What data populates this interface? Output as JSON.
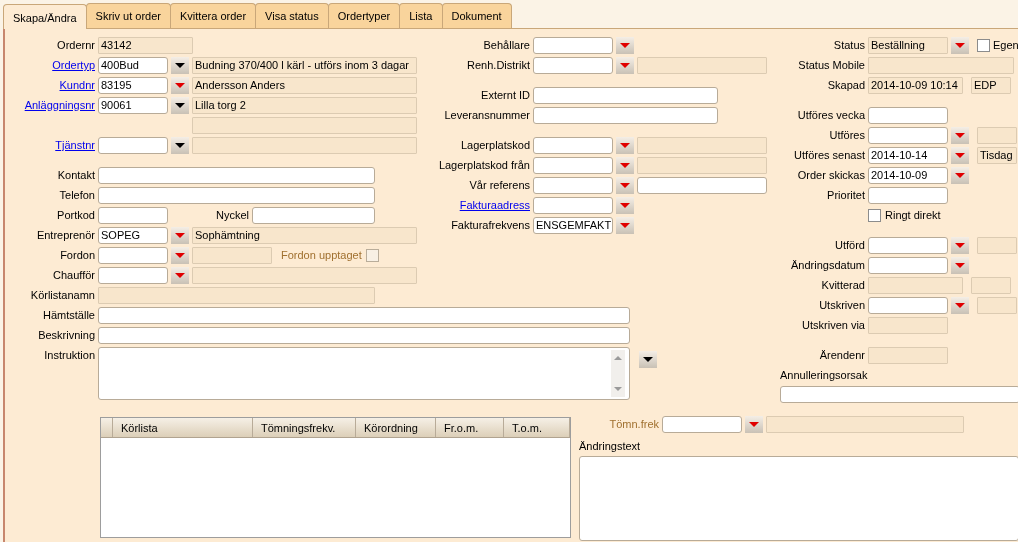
{
  "tabs": [
    {
      "label": "Skapa/Ändra",
      "selected": true
    },
    {
      "label": "Skriv ut order",
      "selected": false
    },
    {
      "label": "Kvittera order",
      "selected": false
    },
    {
      "label": "Visa status",
      "selected": false
    },
    {
      "label": "Ordertyper",
      "selected": false
    },
    {
      "label": "Lista",
      "selected": false
    },
    {
      "label": "Dokument",
      "selected": false
    }
  ],
  "left_groups": [
    [
      {
        "kind": "medium",
        "label": "Ordernr",
        "link": false,
        "field": {
          "value": "43142",
          "readonly": true
        }
      },
      {
        "kind": "text",
        "label": "Ordertyp",
        "link": true,
        "field": {
          "value": "400Bud",
          "readonly": false
        },
        "dropdown": {
          "color": "#000000"
        },
        "extra": {
          "value": "Budning 370/400 l kärl - utförs inom 3 dagar",
          "readonly": true
        }
      },
      {
        "kind": "text",
        "label": "Kundnr",
        "link": true,
        "field": {
          "value": "83195",
          "readonly": false
        },
        "dropdown": {
          "color": "#e00000"
        },
        "extra": {
          "value": "Andersson Anders",
          "readonly": true
        }
      },
      {
        "kind": "text",
        "label": "Anläggningsnr",
        "link": true,
        "field": {
          "value": "90061",
          "readonly": false
        },
        "dropdown": {
          "color": "#000000"
        },
        "extra": {
          "value": "Lilla torg 2",
          "readonly": true
        }
      },
      {
        "kind": "extra-only",
        "extra": {
          "readonly": true
        }
      },
      {
        "kind": "text",
        "label": "Tjänstnr",
        "link": true,
        "field": {
          "readonly": false
        },
        "dropdown": {
          "color": "#000000"
        },
        "extra": {
          "readonly": true
        }
      }
    ],
    [
      {
        "kind": "wide",
        "label": "Kontakt",
        "link": false,
        "field": {
          "readonly": false
        }
      },
      {
        "kind": "wide",
        "label": "Telefon",
        "link": false,
        "field": {
          "readonly": false
        }
      },
      {
        "kind": "text",
        "label": "Portkod",
        "link": false,
        "field": {
          "readonly": false
        },
        "second": {
          "label": "Nyckel",
          "field": {
            "readonly": false
          }
        }
      },
      {
        "kind": "text",
        "label": "Entreprenör",
        "link": false,
        "field": {
          "value": "SOPEG",
          "readonly": false
        },
        "dropdown": {
          "color": "#e00000"
        },
        "extra": {
          "value": "Sophämtning",
          "readonly": true
        }
      },
      {
        "kind": "text",
        "label": "Fordon",
        "link": false,
        "field": {
          "readonly": false
        },
        "dropdown": {
          "color": "#e00000"
        },
        "extra": {
          "readonly": true
        },
        "check": {
          "label": "Fordon upptaget",
          "checked": false,
          "disabled": true
        }
      },
      {
        "kind": "text",
        "label": "Chaufför",
        "link": false,
        "field": {
          "readonly": false
        },
        "dropdown": {
          "color": "#e00000"
        },
        "extra": {
          "readonly": true
        }
      },
      {
        "kind": "wide",
        "label": "Körlistanamn",
        "link": false,
        "field": {
          "readonly": true
        }
      }
    ]
  ],
  "middle_groups": [
    [
      {
        "kind": "text",
        "label": "Behållare",
        "link": false,
        "field": {
          "readonly": false
        },
        "dropdown": {
          "color": "#e00000"
        }
      },
      {
        "kind": "text",
        "label": "Renh.Distrikt",
        "link": false,
        "field": {
          "readonly": false
        },
        "dropdown": {
          "color": "#e00000"
        },
        "extra": {
          "readonly": true
        }
      }
    ],
    [
      {
        "kind": "wide",
        "label": "Externt ID",
        "link": false,
        "field": {
          "readonly": false
        }
      },
      {
        "kind": "wide",
        "label": "Leveransnummer",
        "link": false,
        "field": {
          "readonly": false
        }
      }
    ],
    [
      {
        "kind": "text",
        "label": "Lagerplatskod",
        "link": false,
        "field": {
          "readonly": false
        },
        "dropdown": {
          "color": "#e00000"
        },
        "extra": {
          "readonly": true
        }
      },
      {
        "kind": "text",
        "label": "Lagerplatskod från",
        "link": false,
        "field": {
          "readonly": false
        },
        "dropdown": {
          "color": "#e00000"
        },
        "extra": {
          "readonly": true
        }
      },
      {
        "kind": "text",
        "label": "Vår referens",
        "link": false,
        "field": {
          "readonly": false
        },
        "dropdown": {
          "color": "#e00000"
        },
        "extra": {
          "readonly": false
        }
      },
      {
        "kind": "text",
        "label": "Fakturaadress",
        "link": true,
        "field": {
          "readonly": false
        },
        "dropdown": {
          "color": "#e00000"
        }
      },
      {
        "kind": "text",
        "label": "Fakturafrekvens",
        "link": false,
        "field": {
          "value": "ENSGEMFAKT",
          "readonly": false
        },
        "dropdown": {
          "color": "#e00000"
        }
      }
    ]
  ],
  "lower_rows": [
    {
      "kind": "full",
      "label": "Hämtställe",
      "field": {
        "readonly": false
      }
    },
    {
      "kind": "full",
      "label": "Beskrivning",
      "field": {
        "readonly": false
      }
    },
    {
      "kind": "memo",
      "label": "Instruktion",
      "field": {
        "readonly": false
      },
      "dropdown": {
        "color": "#000000"
      }
    }
  ],
  "right_groups": [
    [
      {
        "kind": "text",
        "label": "Status",
        "link": false,
        "field": {
          "value": "Beställning",
          "readonly": true
        },
        "dropdown": {
          "color": "#e00000"
        },
        "check": {
          "label": "Egen",
          "checked": false,
          "disabled": false
        }
      },
      {
        "kind": "wide",
        "label": "Status Mobile",
        "link": false,
        "field": {
          "readonly": true
        }
      },
      {
        "kind": "medium",
        "label": "Skapad",
        "link": false,
        "field": {
          "value": "2014-10-09 10:14",
          "readonly": true
        },
        "extra": {
          "value": "EDP",
          "readonly": true
        }
      }
    ],
    [
      {
        "kind": "text",
        "label": "Utföres vecka",
        "link": false,
        "field": {
          "readonly": false
        }
      },
      {
        "kind": "text",
        "label": "Utföres",
        "link": false,
        "field": {
          "readonly": false
        },
        "dropdown": {
          "color": "#e00000"
        },
        "extra": {
          "readonly": true
        }
      },
      {
        "kind": "text",
        "label": "Utföres senast",
        "link": false,
        "field": {
          "value": "2014-10-14",
          "readonly": false
        },
        "dropdown": {
          "color": "#e00000"
        },
        "extra": {
          "value": "Tisdag",
          "readonly": true
        }
      },
      {
        "kind": "text",
        "label": "Order skickas",
        "link": false,
        "field": {
          "value": "2014-10-09",
          "readonly": false
        },
        "dropdown": {
          "color": "#e00000"
        }
      },
      {
        "kind": "text",
        "label": "Prioritet",
        "link": false,
        "field": {
          "readonly": false
        }
      },
      {
        "kind": "check",
        "check": {
          "label": "Ringt direkt",
          "checked": false,
          "disabled": false
        }
      }
    ],
    [
      {
        "kind": "text",
        "label": "Utförd",
        "link": false,
        "field": {
          "readonly": false
        },
        "dropdown": {
          "color": "#e00000"
        },
        "extra": {
          "readonly": true
        }
      },
      {
        "kind": "text",
        "label": "Ändringsdatum",
        "link": false,
        "field": {
          "readonly": false
        },
        "dropdown": {
          "color": "#e00000"
        }
      },
      {
        "kind": "medium",
        "label": "Kvitterad",
        "link": false,
        "field": {
          "readonly": true
        },
        "extra": {
          "readonly": true
        }
      },
      {
        "kind": "text",
        "label": "Utskriven",
        "link": false,
        "field": {
          "readonly": false
        },
        "dropdown": {
          "color": "#e00000"
        },
        "extra": {
          "readonly": true
        }
      },
      {
        "kind": "text",
        "label": "Utskriven via",
        "link": false,
        "field": {
          "readonly": true
        }
      }
    ],
    [
      {
        "kind": "text",
        "label": "Ärendenr",
        "link": false,
        "field": {
          "readonly": true
        }
      },
      {
        "kind": "caption",
        "label": "Annulleringsorsak",
        "field": {
          "readonly": false
        }
      }
    ]
  ],
  "grid": {
    "columns": [
      "Körlista",
      "Tömningsfrekv.",
      "Körordning",
      "Fr.o.m.",
      "T.o.m."
    ]
  },
  "tomn_row": {
    "label": "Tömn.frek",
    "disabled": true,
    "field": {
      "readonly": false
    },
    "dropdown": {
      "color": "#e00000"
    },
    "extra": {
      "readonly": true
    }
  },
  "change_text": {
    "label": "Ändringstext",
    "field": {
      "readonly": false
    }
  }
}
